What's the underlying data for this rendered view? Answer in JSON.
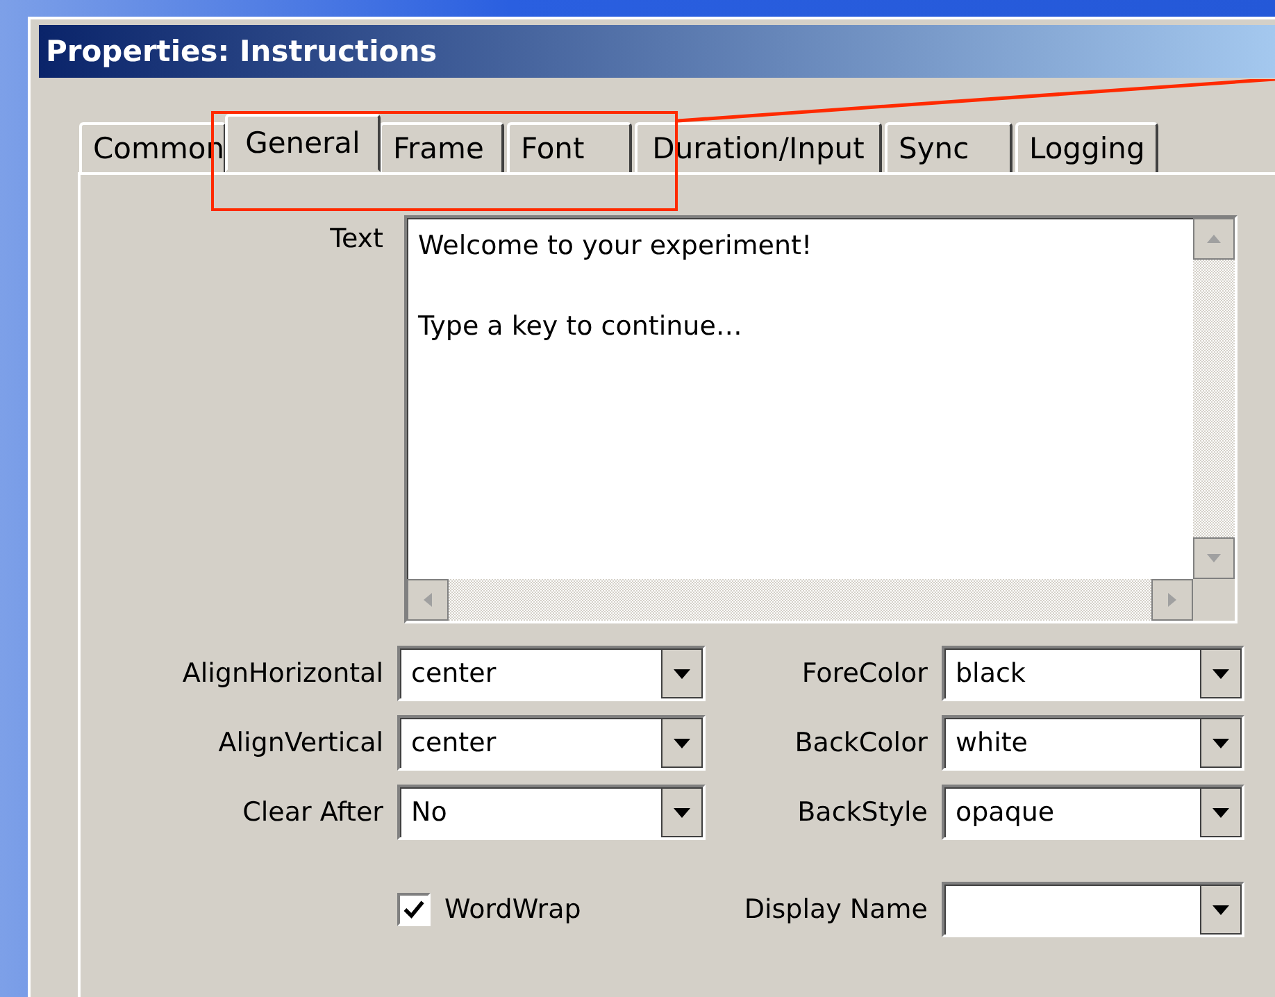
{
  "window": {
    "title": "Properties: Instructions"
  },
  "tabs": [
    {
      "label": "Common",
      "selected": false
    },
    {
      "label": "General",
      "selected": true
    },
    {
      "label": "Frame",
      "selected": false
    },
    {
      "label": "Font",
      "selected": false
    },
    {
      "label": "Duration/Input",
      "selected": false
    },
    {
      "label": "Sync",
      "selected": false
    },
    {
      "label": "Logging",
      "selected": false
    }
  ],
  "text_field": {
    "label": "Text",
    "value": "Welcome to your experiment!\n\nType a key to continue…"
  },
  "fields": [
    {
      "label": "AlignHorizontal",
      "value": "center"
    },
    {
      "label": "ForeColor",
      "value": "black"
    },
    {
      "label": "AlignVertical",
      "value": "center"
    },
    {
      "label": "BackColor",
      "value": "white"
    },
    {
      "label": "Clear After",
      "value": "No"
    },
    {
      "label": "BackStyle",
      "value": "opaque"
    }
  ],
  "word_wrap": {
    "label": "WordWrap",
    "checked": true
  },
  "display_name": {
    "label": "Display Name"
  }
}
